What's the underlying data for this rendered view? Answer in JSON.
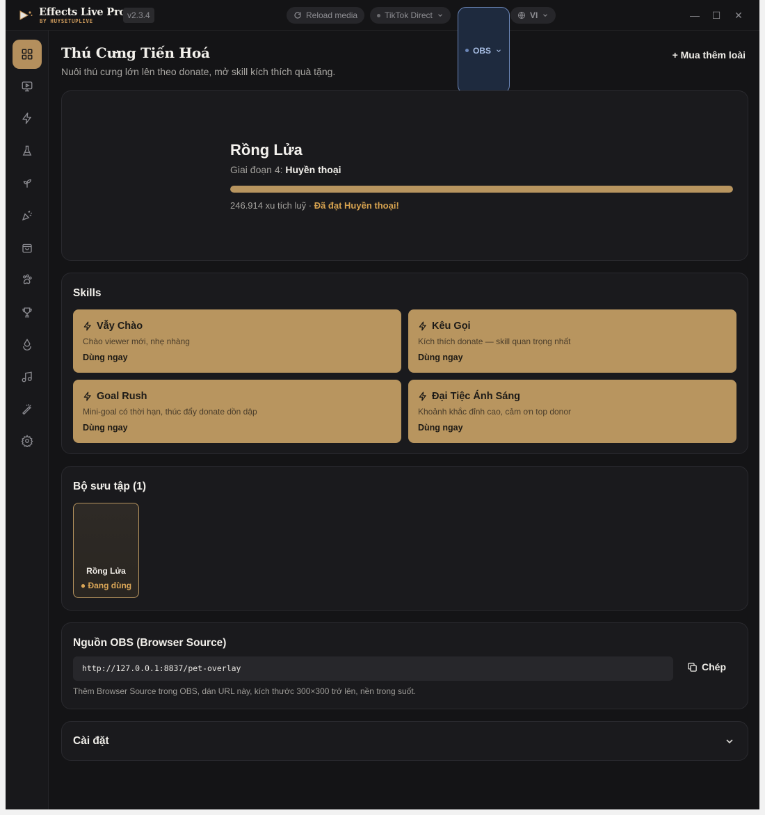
{
  "titlebar": {
    "app_name": "Effects Live Pro",
    "app_sub": "BY HUYSETUPLIVE",
    "version": "v2.3.4",
    "reload_label": "Reload media",
    "source_label": "TikTok Direct",
    "obs_label": "OBS",
    "lang_label": "VI",
    "minimize": "—",
    "maximize": "☐",
    "close": "✕"
  },
  "sidebar": {
    "items": [
      {
        "icon": "dashboard-icon",
        "active": true
      },
      {
        "icon": "screen-play-icon"
      },
      {
        "icon": "lightning-icon"
      },
      {
        "icon": "flask-icon"
      },
      {
        "icon": "sprout-icon"
      },
      {
        "icon": "party-popper-icon"
      },
      {
        "icon": "shopping-bag-icon"
      },
      {
        "icon": "paw-icon"
      },
      {
        "icon": "trophy-icon"
      },
      {
        "icon": "cloud-icon"
      },
      {
        "icon": "music-icon"
      },
      {
        "icon": "magic-wand-icon"
      },
      {
        "icon": "gear-icon"
      }
    ]
  },
  "page": {
    "title": "Thú Cưng Tiến Hoá",
    "subtitle": "Nuôi thú cưng lớn lên theo donate, mở skill kích thích quà tặng.",
    "buy_more": "+ Mua thêm loài"
  },
  "pet": {
    "name": "Rồng Lửa",
    "stage_prefix": "Giai đoạn 4:",
    "stage_name": "Huyền thoại",
    "progress": 1.0,
    "coins_text": "246.914 xu tích luỹ ·",
    "goal_text": "Đã đạt Huyền thoại!"
  },
  "skills": {
    "title": "Skills",
    "items": [
      {
        "name": "Vẫy Chào",
        "desc": "Chào viewer mới, nhẹ nhàng",
        "action": "Dùng ngay"
      },
      {
        "name": "Kêu Gọi",
        "desc": "Kích thích donate — skill quan trọng nhất",
        "action": "Dùng ngay"
      },
      {
        "name": "Goal Rush",
        "desc": "Mini-goal có thời hạn, thúc đẩy donate dồn dập",
        "action": "Dùng ngay"
      },
      {
        "name": "Đại Tiệc Ánh Sáng",
        "desc": "Khoảnh khắc đỉnh cao, cảm ơn top donor",
        "action": "Dùng ngay"
      }
    ]
  },
  "collection": {
    "title": "Bộ sưu tập (1)",
    "items": [
      {
        "name": "Rồng Lửa",
        "status": "● Đang dùng"
      }
    ]
  },
  "obs": {
    "title": "Nguồn OBS (Browser Source)",
    "url": "http://127.0.0.1:8837/pet-overlay",
    "copy_label": "Chép",
    "hint": "Thêm Browser Source trong OBS, dán URL này, kích thước 300×300 trở lên, nền trong suốt."
  },
  "settings": {
    "title": "Cài đặt"
  },
  "colors": {
    "accent": "#b8955f",
    "gold_text": "#d6a24f",
    "background": "#141416",
    "card": "#1a1a1d"
  }
}
